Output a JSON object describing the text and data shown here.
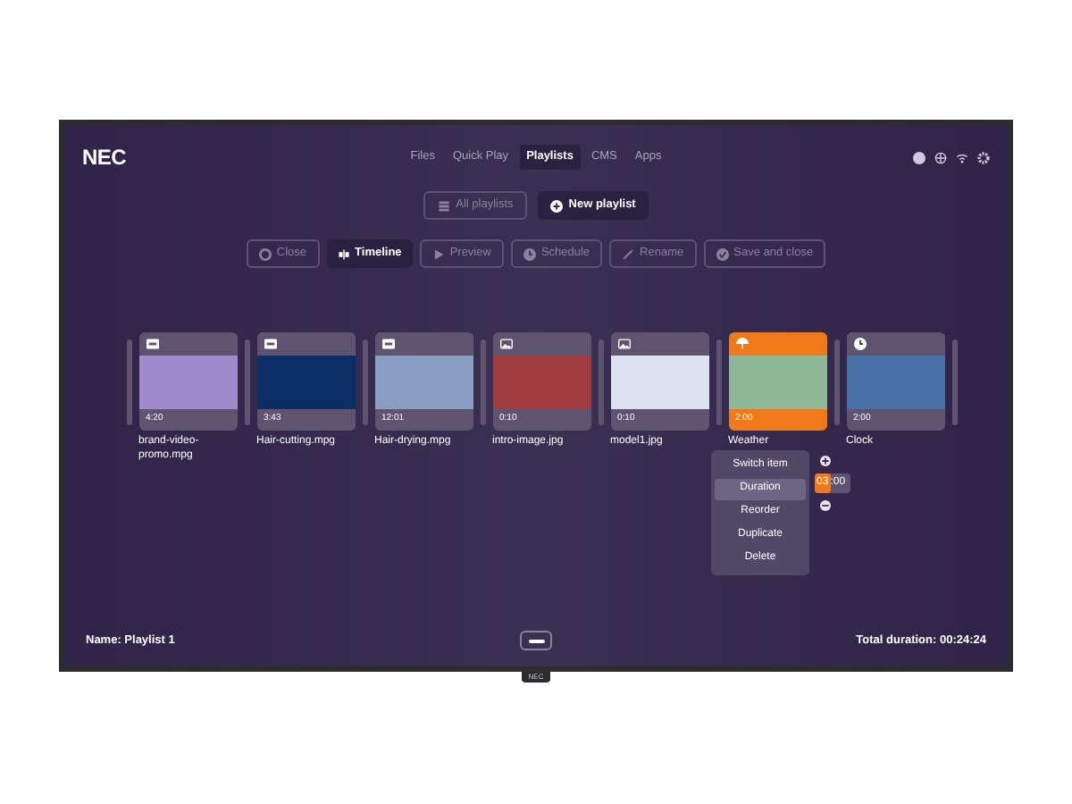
{
  "brand": "NEC",
  "nav": [
    {
      "label": "Files",
      "selected": false
    },
    {
      "label": "Quick Play",
      "selected": false
    },
    {
      "label": "Playlists",
      "selected": true
    },
    {
      "label": "CMS",
      "selected": false
    },
    {
      "label": "Apps",
      "selected": false
    }
  ],
  "playlist_buttons": [
    {
      "label": "All playlists",
      "kind": "list",
      "disabled": true
    },
    {
      "label": "New playlist",
      "kind": "plus",
      "disabled": false
    }
  ],
  "toolbar": [
    {
      "label": "Close",
      "kind": "close",
      "selected": false
    },
    {
      "label": "Timeline",
      "kind": "timeline",
      "selected": true
    },
    {
      "label": "Preview",
      "kind": "play",
      "selected": false
    },
    {
      "label": "Schedule",
      "kind": "clock",
      "selected": false
    },
    {
      "label": "Rename",
      "kind": "pen",
      "selected": false
    },
    {
      "label": "Save and close",
      "kind": "check",
      "selected": false
    }
  ],
  "timeline": [
    {
      "name": "brand-video-promo.mpg",
      "duration": "4:20",
      "kind": "video",
      "color": "#a08ccc",
      "selected": false
    },
    {
      "name": "Hair-cutting.mpg",
      "duration": "3:43",
      "kind": "video",
      "color": "#0c2e66",
      "selected": false
    },
    {
      "name": "Hair-drying.mpg",
      "duration": "12:01",
      "kind": "video",
      "color": "#8a9ec2",
      "selected": false
    },
    {
      "name": "intro-image.jpg",
      "duration": "0:10",
      "kind": "image",
      "color": "#a03c40",
      "selected": false
    },
    {
      "name": "model1.jpg",
      "duration": "0:10",
      "kind": "image",
      "color": "#dde2f0",
      "selected": false
    },
    {
      "name": "Weather",
      "duration": "2:00",
      "kind": "weather",
      "color": "#8fb898",
      "selected": true
    },
    {
      "name": "Clock",
      "duration": "2:00",
      "kind": "clock",
      "color": "#4a72a8",
      "selected": false
    }
  ],
  "context_menu": [
    {
      "label": "Switch item",
      "selected": false
    },
    {
      "label": "Duration",
      "selected": true
    },
    {
      "label": "Reorder",
      "selected": false
    },
    {
      "label": "Duplicate",
      "selected": false
    },
    {
      "label": "Delete",
      "selected": false
    }
  ],
  "duration_field": {
    "selected_part": "03",
    "rest": ":00"
  },
  "status_bar": {
    "name": "Name: Playlist 1",
    "total": "Total duration: 00:24:24"
  },
  "bezel_logo": "NEC"
}
